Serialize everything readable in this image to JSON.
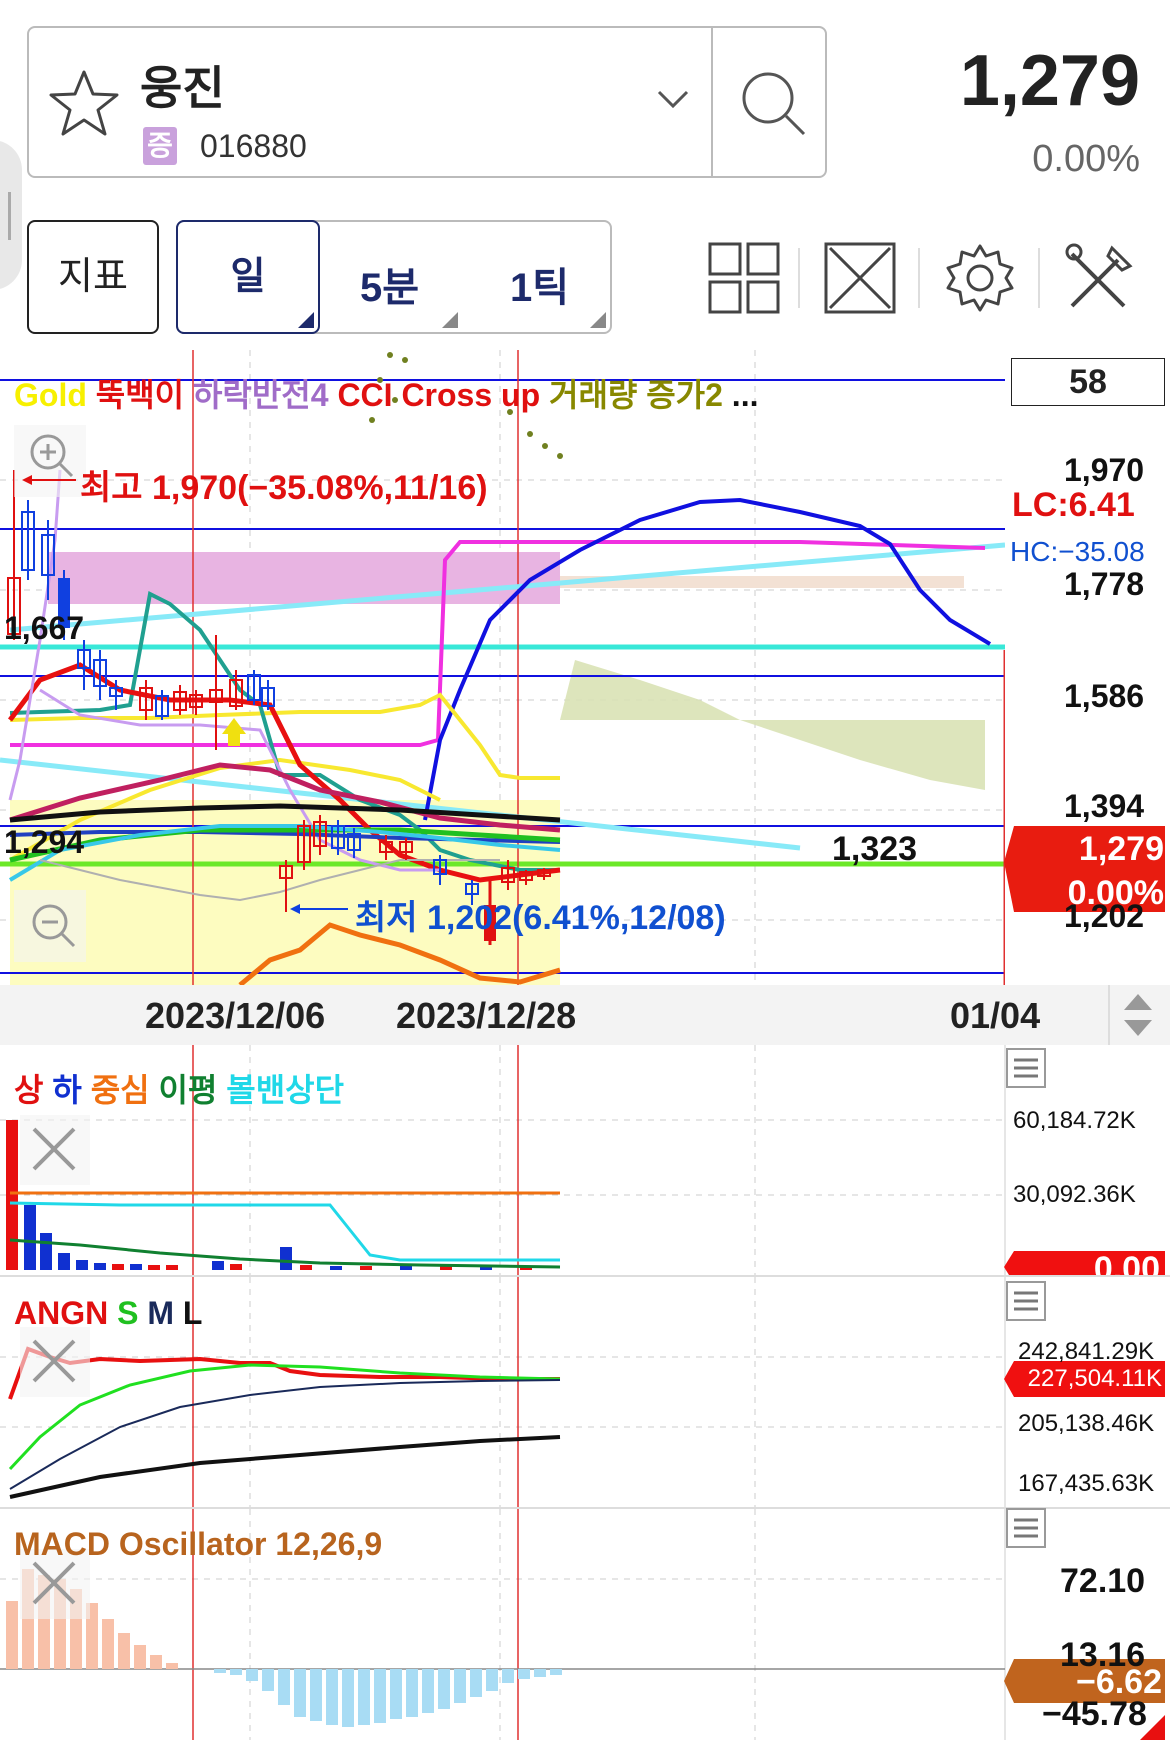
{
  "header": {
    "stock_name": "웅진",
    "market_badge": "증",
    "stock_code": "016880",
    "price": "1,279",
    "change": "0.00%"
  },
  "toolbar": {
    "indicator_label": "지표",
    "day_label": "일",
    "min5_label": "5분",
    "tick1_label": "1틱",
    "icons": [
      "layout-grid-icon",
      "fullscreen-icon",
      "settings-icon",
      "tools-icon"
    ]
  },
  "main_chart": {
    "legend": [
      {
        "text": "Gold",
        "color": "#f7f000"
      },
      {
        "text": "뚝백이",
        "color": "#e01010"
      },
      {
        "text": "하락반전4",
        "color": "#a06cc8"
      },
      {
        "text": "CCI Cross up",
        "color": "#e01010"
      },
      {
        "text": "거래량 증가2",
        "color": "#888800"
      },
      {
        "text": "...",
        "color": "#111111"
      }
    ],
    "count_box": "58",
    "high_annot": "최고 1,970(−35.08%,11/16)",
    "low_annot": "최저 1,202(6.41%,12/08)",
    "lc_label": "LC:6.41",
    "hc_label": "HC:−35.08",
    "left_label_top": "1,667",
    "left_label_bottom": "1,294",
    "mid_label": "1,323",
    "price_box_value": "1,279",
    "price_box_change": "0.00%",
    "y_ticks": [
      "1,970",
      "1,778",
      "1,586",
      "1,394",
      "1,202"
    ]
  },
  "dates": [
    "2023/12/06",
    "2023/12/28",
    "01/04"
  ],
  "panels": {
    "volume": {
      "legend": [
        {
          "text": "상",
          "color": "#e01010"
        },
        {
          "text": "하",
          "color": "#1030d0"
        },
        {
          "text": "중심",
          "color": "#f07010"
        },
        {
          "text": "이평",
          "color": "#108030"
        },
        {
          "text": "볼밴상단",
          "color": "#20d8e8"
        }
      ],
      "y_ticks": [
        "60,184.72K",
        "30,092.36K",
        "0.00"
      ],
      "current": "0.00"
    },
    "angn": {
      "legend": [
        {
          "text": "ANGN",
          "color": "#e01010"
        },
        {
          "text": "S",
          "color": "#20c020"
        },
        {
          "text": "M",
          "color": "#1a2a5a"
        },
        {
          "text": "L",
          "color": "#111111"
        }
      ],
      "y_ticks": [
        "242,841.29K",
        "205,138.46K",
        "167,435.63K"
      ],
      "current": "227,504.11K"
    },
    "macd": {
      "legend": [
        {
          "text": "MACD Oscillator 12,26,9",
          "color": "#b8641e"
        }
      ],
      "y_ticks": [
        "72.10",
        "13.16",
        "−45.78"
      ],
      "current": "−6.62"
    }
  }
}
